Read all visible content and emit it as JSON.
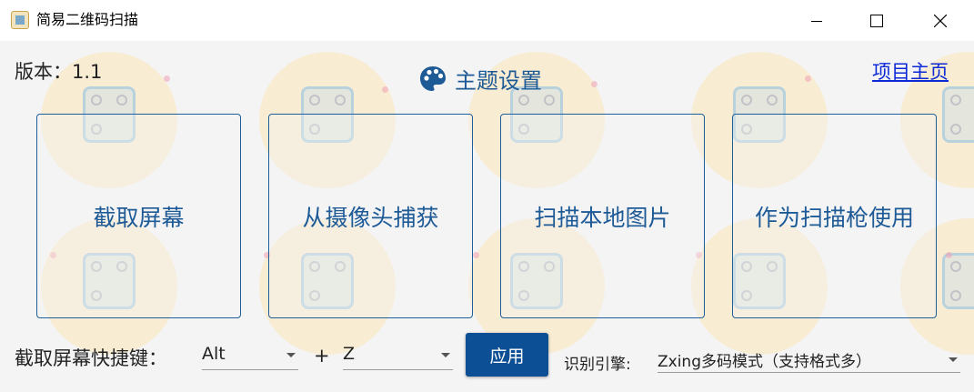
{
  "window": {
    "title": "简易二维码扫描",
    "controls": [
      "minimize-icon",
      "maximize-icon",
      "close-icon"
    ]
  },
  "header": {
    "version": "版本：1.1",
    "theme_label": "主题设置",
    "theme_icon": "palette-icon",
    "homepage_link": "项目主页"
  },
  "actions": [
    {
      "label": "截取屏幕"
    },
    {
      "label": "从摄像头捕获"
    },
    {
      "label": "扫描本地图片"
    },
    {
      "label": "作为扫描枪使用"
    }
  ],
  "hotkey": {
    "label": "截取屏幕快捷键：",
    "modifier": "Alt",
    "plus": "+",
    "key": "Z",
    "apply_label": "应用"
  },
  "engine": {
    "label": "识别引擎:",
    "value": "Zxing多码模式（支持格式多）"
  },
  "colors": {
    "accent": "#1d5a96",
    "button": "#0d4f94",
    "link": "#0b29d6",
    "background": "#f4f4f4"
  }
}
